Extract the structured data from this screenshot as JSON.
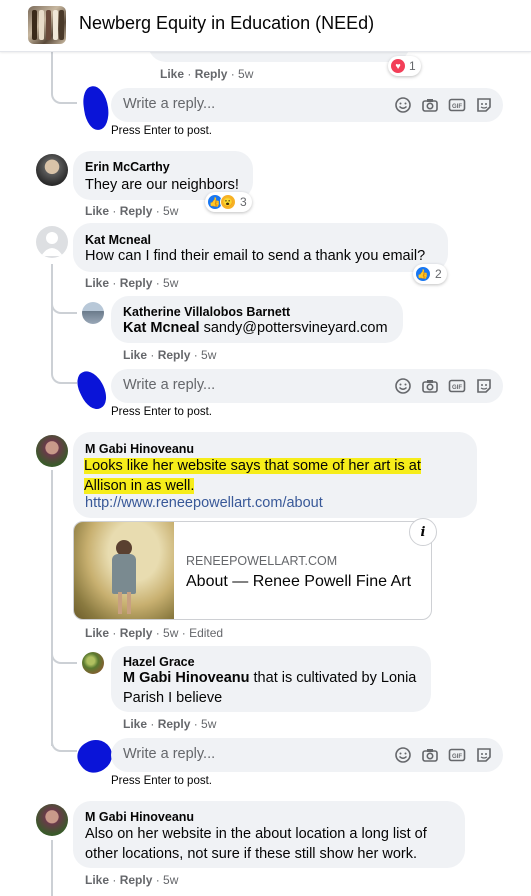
{
  "header": {
    "group_name": "Newberg Equity in Education (NEEd)"
  },
  "colors": {
    "accent": "#1877f2",
    "highlight": "#f6ed1a",
    "scribble": "#0a14d8",
    "bubble": "#f0f2f5",
    "meta": "#65676b"
  },
  "top_comment": {
    "like": "Like",
    "reply": "Reply",
    "time": "5w",
    "reaction": {
      "icon": "heart-icon",
      "count": "1"
    }
  },
  "reply_box": {
    "placeholder": "Write a reply...",
    "hint": "Press Enter to post.",
    "icons": [
      "emoji-icon",
      "camera-icon",
      "gif-icon",
      "sticker-icon"
    ]
  },
  "comments": [
    {
      "author": "Erin McCarthy",
      "text": "They are our neighbors!",
      "like": "Like",
      "reply": "Reply",
      "time": "5w",
      "reaction": {
        "icons": [
          "like-icon",
          "wow-icon"
        ],
        "count": "3"
      }
    },
    {
      "author": "Kat Mcneal",
      "text": "How can I find their email to send a thank you email?",
      "like": "Like",
      "reply": "Reply",
      "time": "5w",
      "reaction": {
        "icons": [
          "like-icon"
        ],
        "count": "2"
      },
      "replies": [
        {
          "author": "Katherine Villalobos Barnett",
          "mention": "Kat Mcneal",
          "text": "sandy@pottersvineyard.com",
          "like": "Like",
          "reply": "Reply",
          "time": "5w"
        }
      ]
    },
    {
      "author": "M Gabi Hinoveanu",
      "text_line1": "Looks like her website says that some of her art is at",
      "text_line2": "Allison in as well.",
      "url": "http://www.reneepowellart.com/about",
      "preview": {
        "domain": "RENEEPOWELLART.COM",
        "title": "About — Renee Powell Fine Art"
      },
      "like": "Like",
      "reply": "Reply",
      "time": "5w",
      "edited": "Edited",
      "replies": [
        {
          "author": "Hazel Grace",
          "mention": "M Gabi Hinoveanu",
          "text_line1": "that is cultivated by Lonia",
          "text_line2": "Parish I believe",
          "like": "Like",
          "reply": "Reply",
          "time": "5w"
        }
      ]
    },
    {
      "author": "M Gabi Hinoveanu",
      "text_line1": "Also on her website in the about location a long list of",
      "text_line2": "other locations, not sure if these still show her work.",
      "like": "Like",
      "reply": "Reply",
      "time": "5w"
    }
  ]
}
